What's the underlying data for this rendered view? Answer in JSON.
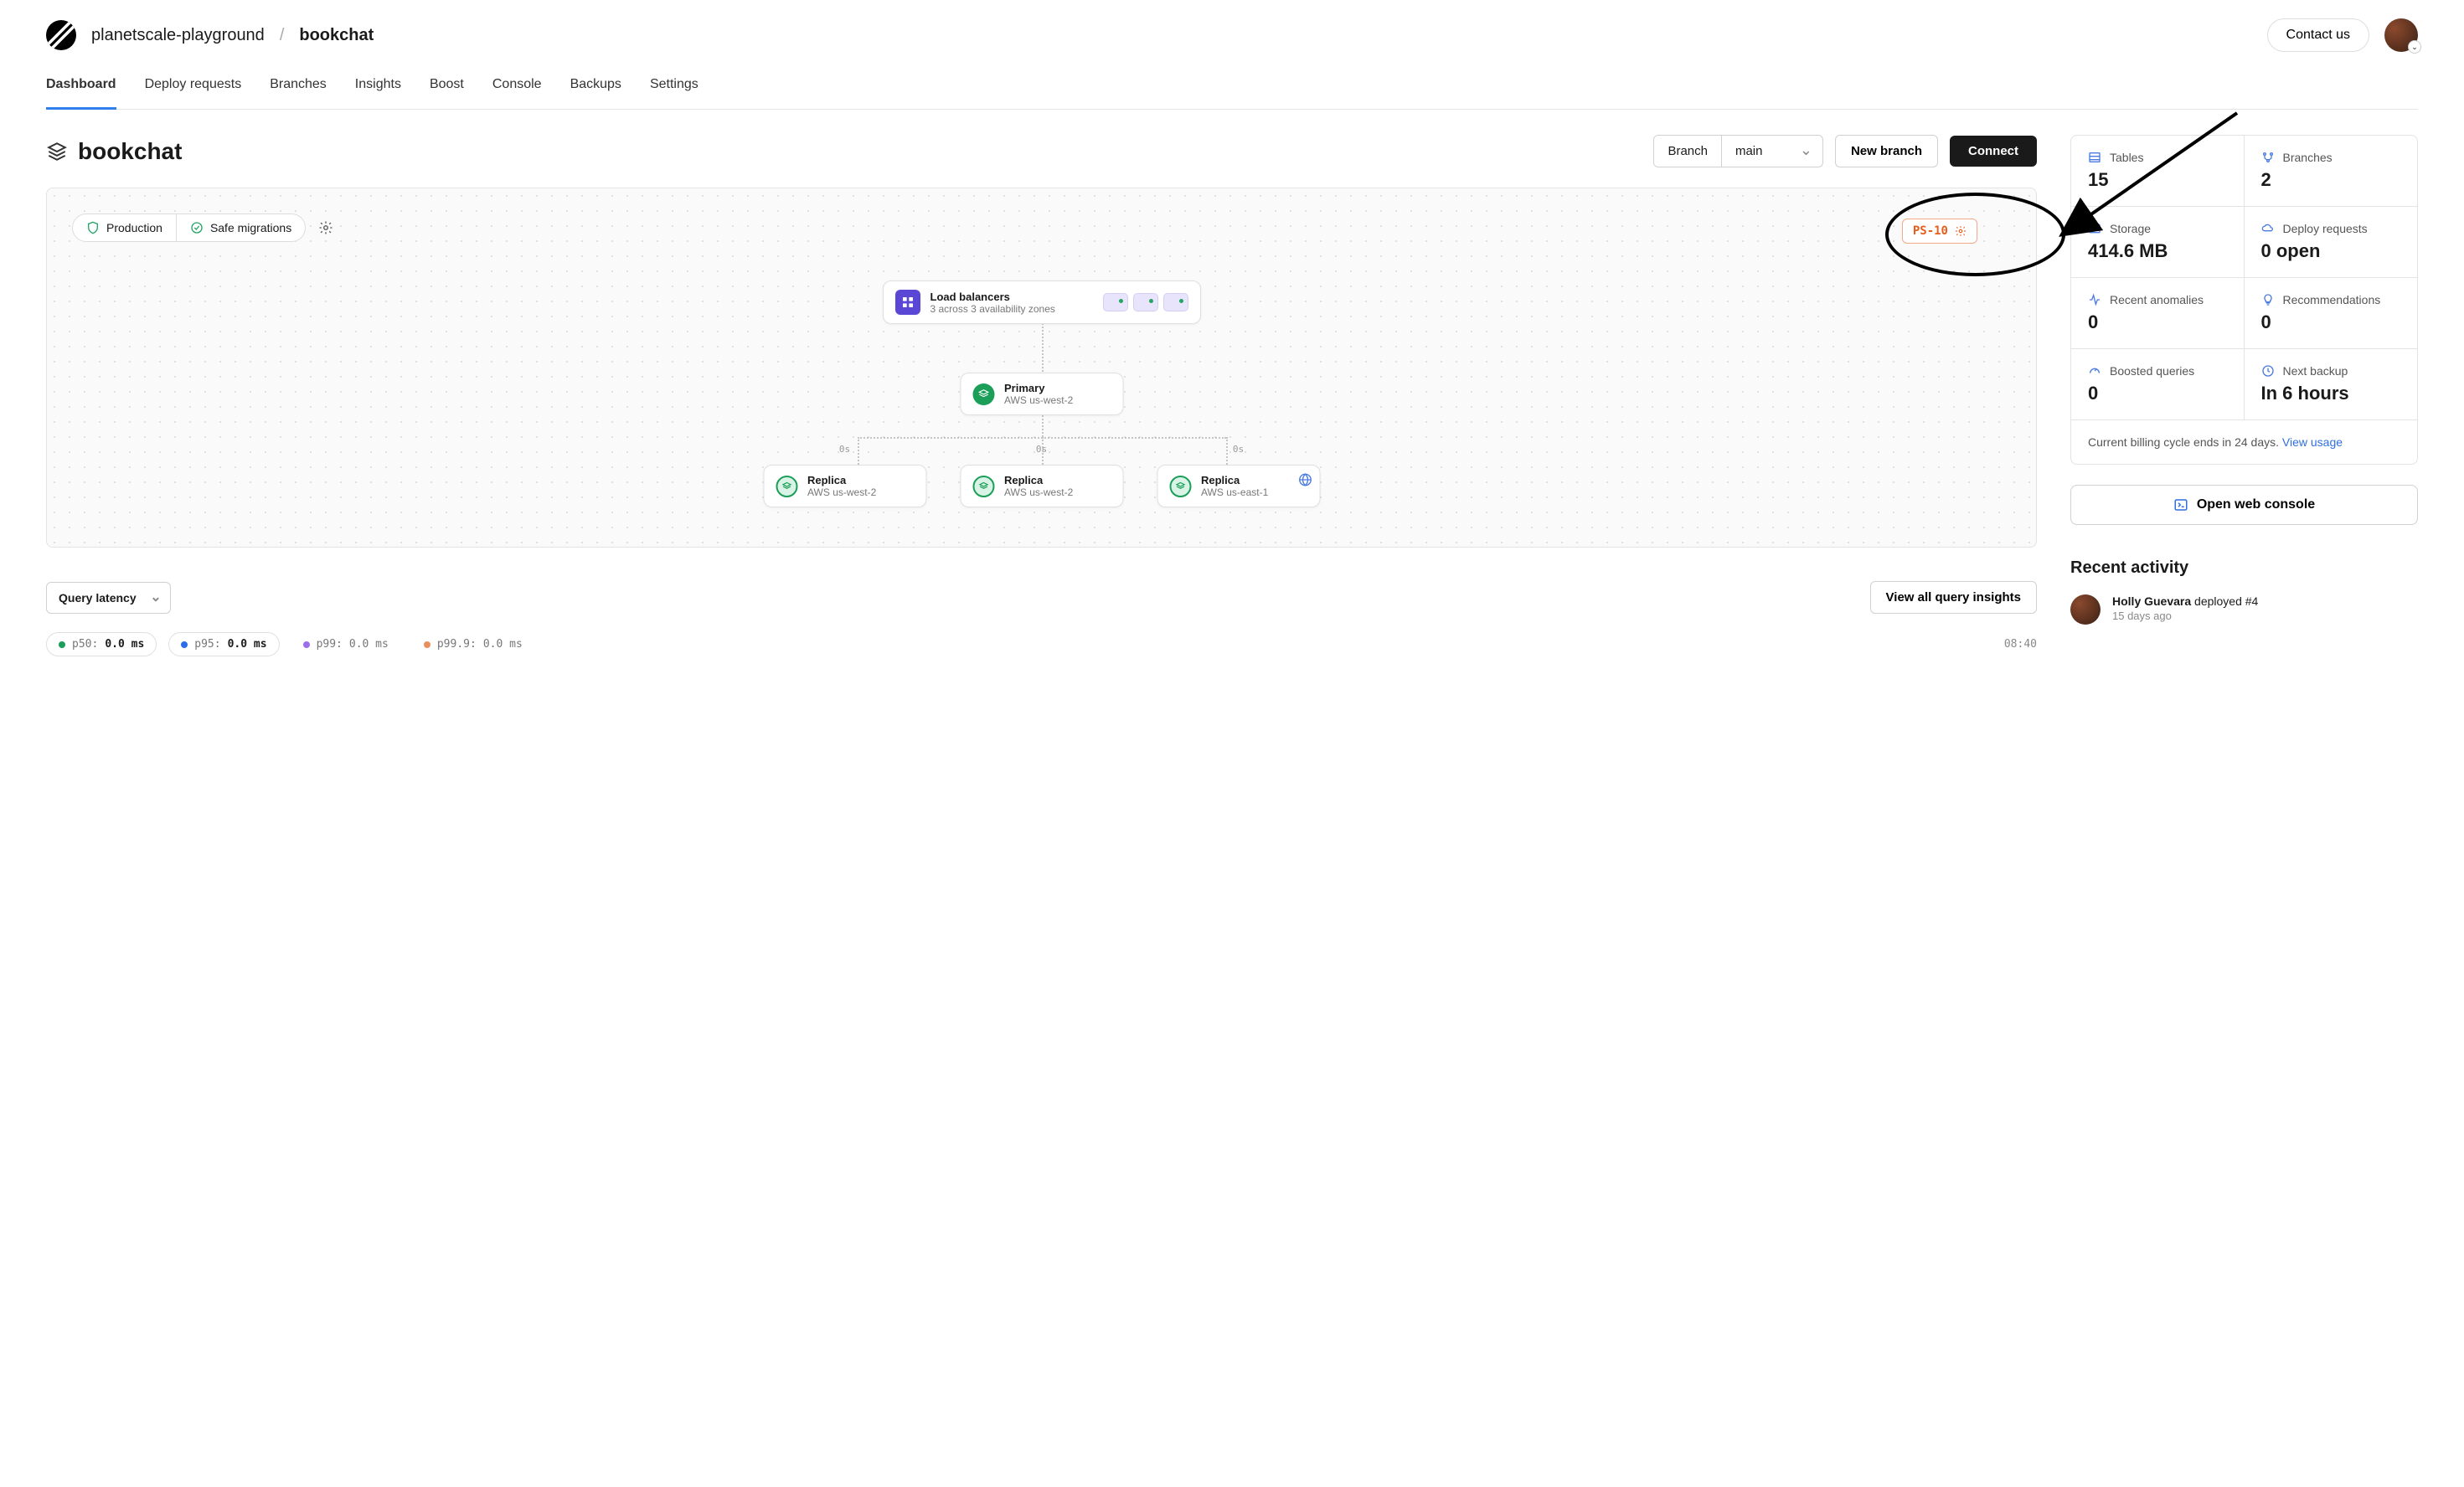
{
  "breadcrumb": {
    "org": "planetscale-playground",
    "db": "bookchat"
  },
  "header": {
    "contact": "Contact us"
  },
  "tabs": [
    "Dashboard",
    "Deploy requests",
    "Branches",
    "Insights",
    "Boost",
    "Console",
    "Backups",
    "Settings"
  ],
  "title": "bookchat",
  "branch_picker": {
    "label": "Branch",
    "value": "main"
  },
  "actions": {
    "new_branch": "New branch",
    "connect": "Connect"
  },
  "panel": {
    "chips": {
      "production": "Production",
      "safe_migrations": "Safe migrations"
    },
    "badge": "PS-10",
    "load_balancer": {
      "title": "Load balancers",
      "subtitle": "3 across 3 availability zones"
    },
    "primary": {
      "title": "Primary",
      "region": "AWS us-west-2"
    },
    "replicas": [
      {
        "title": "Replica",
        "region": "AWS us-west-2",
        "delay": "0s"
      },
      {
        "title": "Replica",
        "region": "AWS us-west-2",
        "delay": "0s"
      },
      {
        "title": "Replica",
        "region": "AWS us-east-1",
        "delay": "0s",
        "remote": true
      }
    ]
  },
  "query_latency": {
    "selector": "Query latency",
    "view_all": "View all query insights",
    "series": [
      {
        "label": "p50:",
        "value": "0.0 ms",
        "color": "#1a9e58",
        "bordered": true
      },
      {
        "label": "p95:",
        "value": "0.0 ms",
        "color": "#2a6fe8",
        "bordered": true
      },
      {
        "label": "p99:",
        "value": "0.0 ms",
        "color": "#9a6fe8",
        "bordered": false
      },
      {
        "label": "p99.9:",
        "value": "0.0 ms",
        "color": "#e8905d",
        "bordered": false
      }
    ],
    "timestamp": "08:40"
  },
  "stats": {
    "tables": {
      "label": "Tables",
      "value": "15"
    },
    "branches": {
      "label": "Branches",
      "value": "2"
    },
    "storage": {
      "label": "Storage",
      "value": "414.6 MB"
    },
    "deploy_requests": {
      "label": "Deploy requests",
      "value": "0 open"
    },
    "anomalies": {
      "label": "Recent anomalies",
      "value": "0"
    },
    "recommendations": {
      "label": "Recommendations",
      "value": "0"
    },
    "boosted": {
      "label": "Boosted queries",
      "value": "0"
    },
    "next_backup": {
      "label": "Next backup",
      "value": "In 6 hours"
    },
    "billing_text": "Current billing cycle ends in 24 days. ",
    "billing_link": "View usage"
  },
  "console_button": "Open web console",
  "recent_activity": {
    "heading": "Recent activity",
    "items": [
      {
        "who": "Holly Guevara",
        "action": " deployed #4",
        "time": "15 days ago"
      }
    ]
  }
}
